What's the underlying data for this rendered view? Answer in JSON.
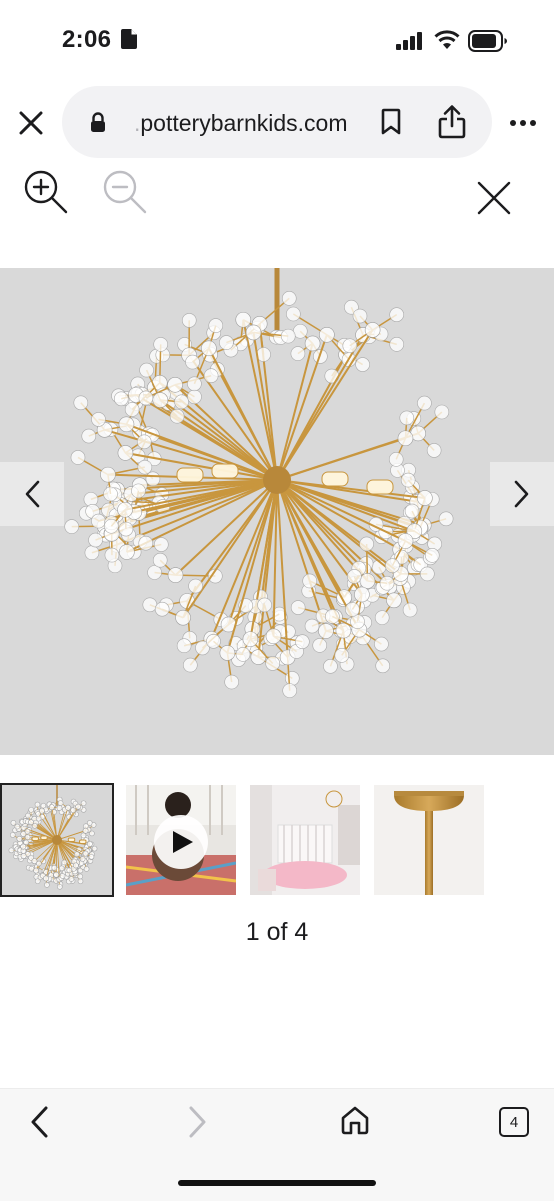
{
  "status_bar": {
    "time": "2:06"
  },
  "browser": {
    "url_prefix": ".",
    "url_domain": "potterybarnkids.com"
  },
  "gallery": {
    "counter": "1 of 4",
    "thumbnails": [
      {
        "kind": "chandelier",
        "selected": true
      },
      {
        "kind": "video-child",
        "selected": false
      },
      {
        "kind": "nursery-room",
        "selected": false
      },
      {
        "kind": "ceiling-canopy",
        "selected": false
      }
    ]
  },
  "toolbar": {
    "tab_count": "4"
  },
  "colors": {
    "accent": "#1c1c1e",
    "disabled": "#bdbdc2",
    "image_bg": "#d9d9d9",
    "brass": "#c8963e"
  },
  "icons": [
    "document-icon",
    "signal-icon",
    "wifi-icon",
    "battery-icon",
    "close-icon",
    "lock-icon",
    "bookmark-icon",
    "share-icon",
    "more-icon",
    "zoom-in-icon",
    "zoom-out-icon",
    "chevron-left-icon",
    "chevron-right-icon",
    "play-icon",
    "back-icon",
    "forward-icon",
    "home-icon",
    "tabs-icon"
  ]
}
